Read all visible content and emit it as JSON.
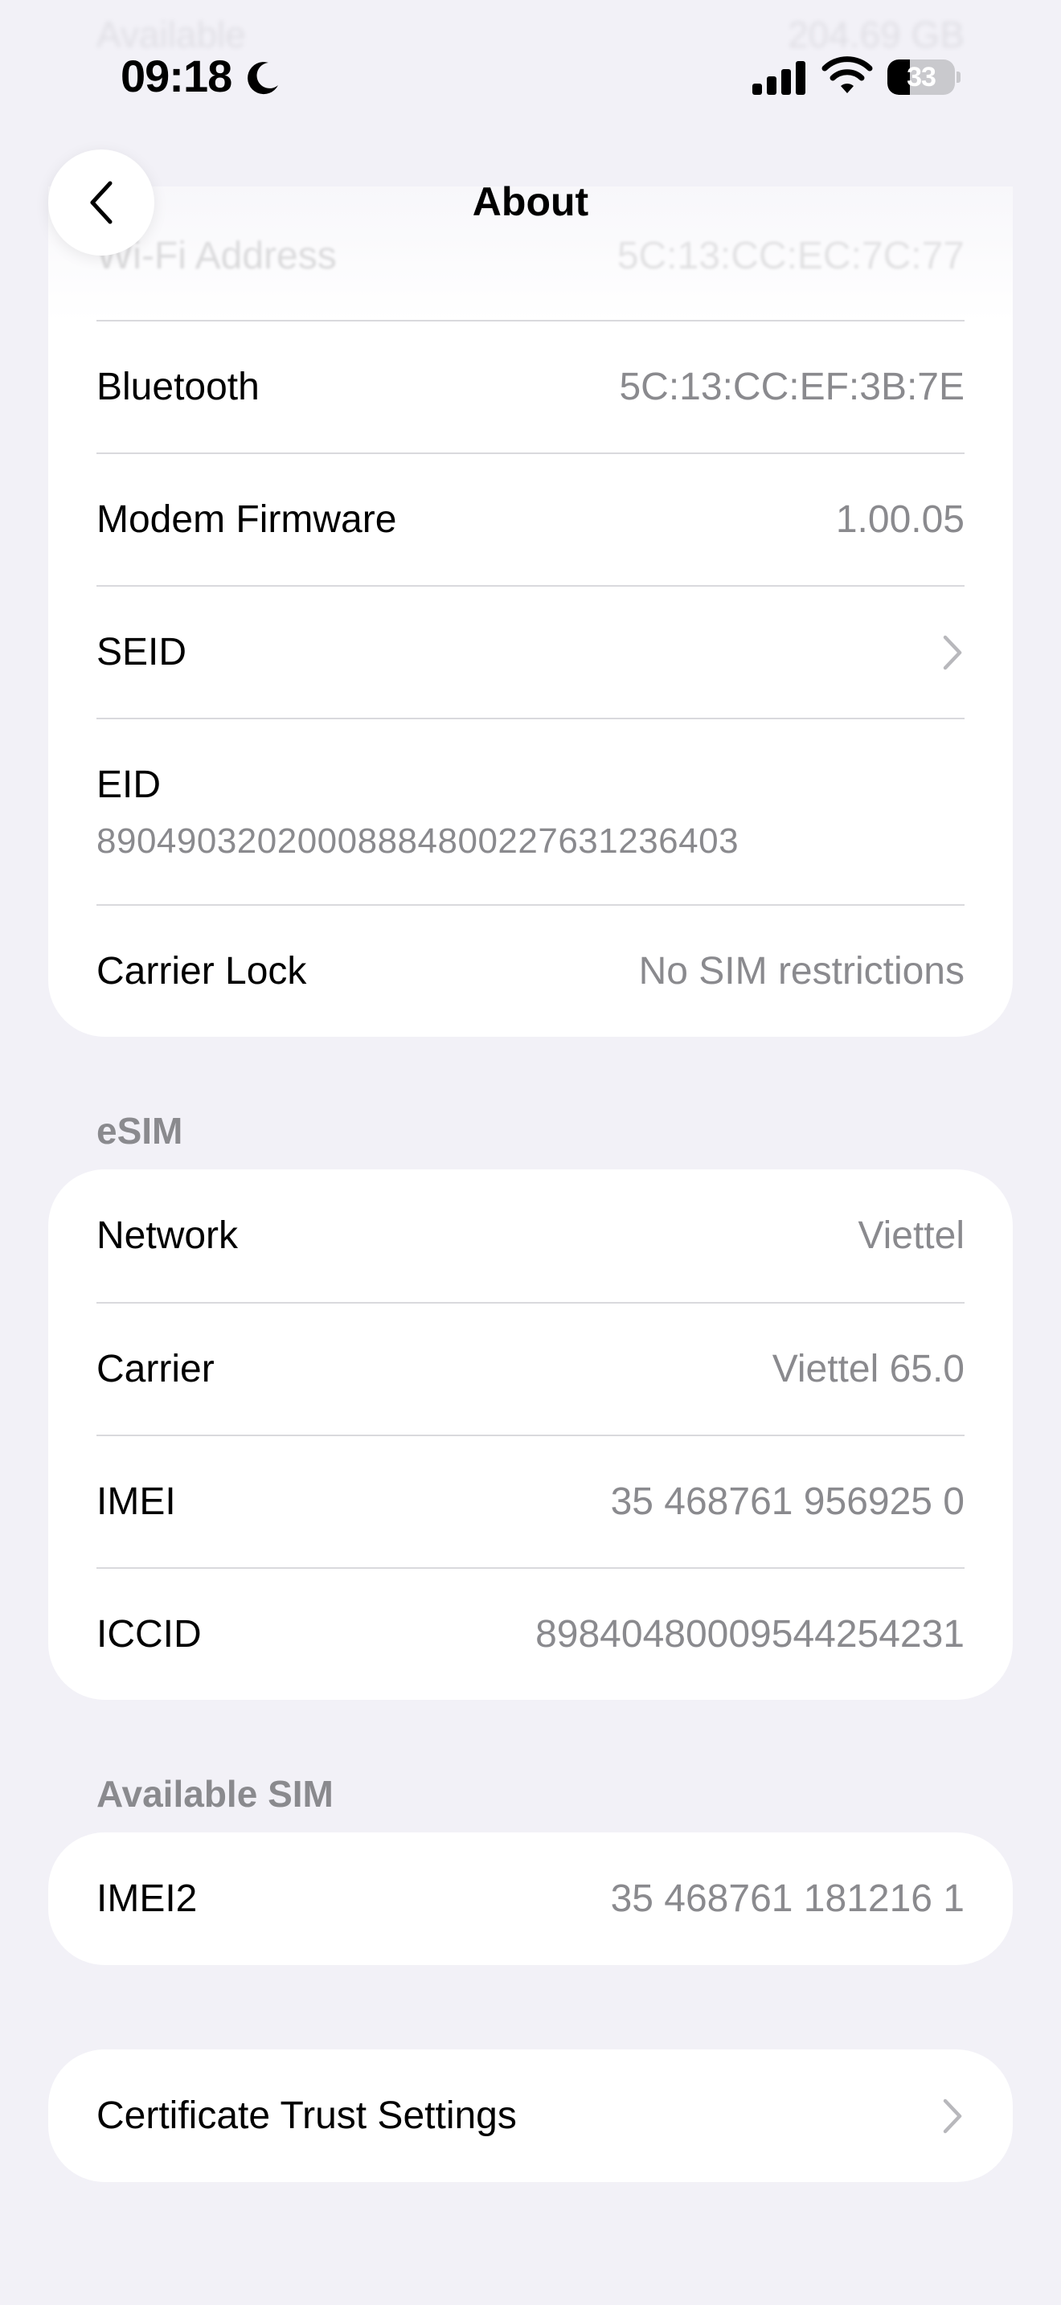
{
  "status_bar": {
    "time": "09:18",
    "battery_percent": "33",
    "battery_level": 0.33
  },
  "nav": {
    "title": "About"
  },
  "ghost": {
    "label": "Available",
    "value": "204.69 GB"
  },
  "group_device": {
    "rows": [
      {
        "label": "Wi-Fi Address",
        "value": "5C:13:CC:EC:7C:77"
      },
      {
        "label": "Bluetooth",
        "value": "5C:13:CC:EF:3B:7E"
      },
      {
        "label": "Modem Firmware",
        "value": "1.00.05"
      },
      {
        "label": "SEID",
        "value": ""
      },
      {
        "label": "EID",
        "value": "89049032020008884800227631236403"
      },
      {
        "label": "Carrier Lock",
        "value": "No SIM restrictions"
      }
    ]
  },
  "esim": {
    "header": "eSIM",
    "rows": [
      {
        "label": "Network",
        "value": "Viettel"
      },
      {
        "label": "Carrier",
        "value": "Viettel 65.0"
      },
      {
        "label": "IMEI",
        "value": "35 468761 956925 0"
      },
      {
        "label": "ICCID",
        "value": "89840480009544254231"
      }
    ]
  },
  "available_sim": {
    "header": "Available SIM",
    "rows": [
      {
        "label": "IMEI2",
        "value": "35 468761 181216 1"
      }
    ]
  },
  "certificate": {
    "label": "Certificate Trust Settings"
  },
  "icons": {
    "back": "chevron-left-icon",
    "disclosure": "chevron-right-icon",
    "moon": "moon-icon",
    "signal": "cellular-signal-icon",
    "wifi": "wifi-icon",
    "battery": "battery-icon"
  },
  "colors": {
    "background": "#f2f1f7",
    "card": "#ffffff",
    "secondary_text": "#8a8a8e",
    "separator": "#d9d9dd"
  }
}
